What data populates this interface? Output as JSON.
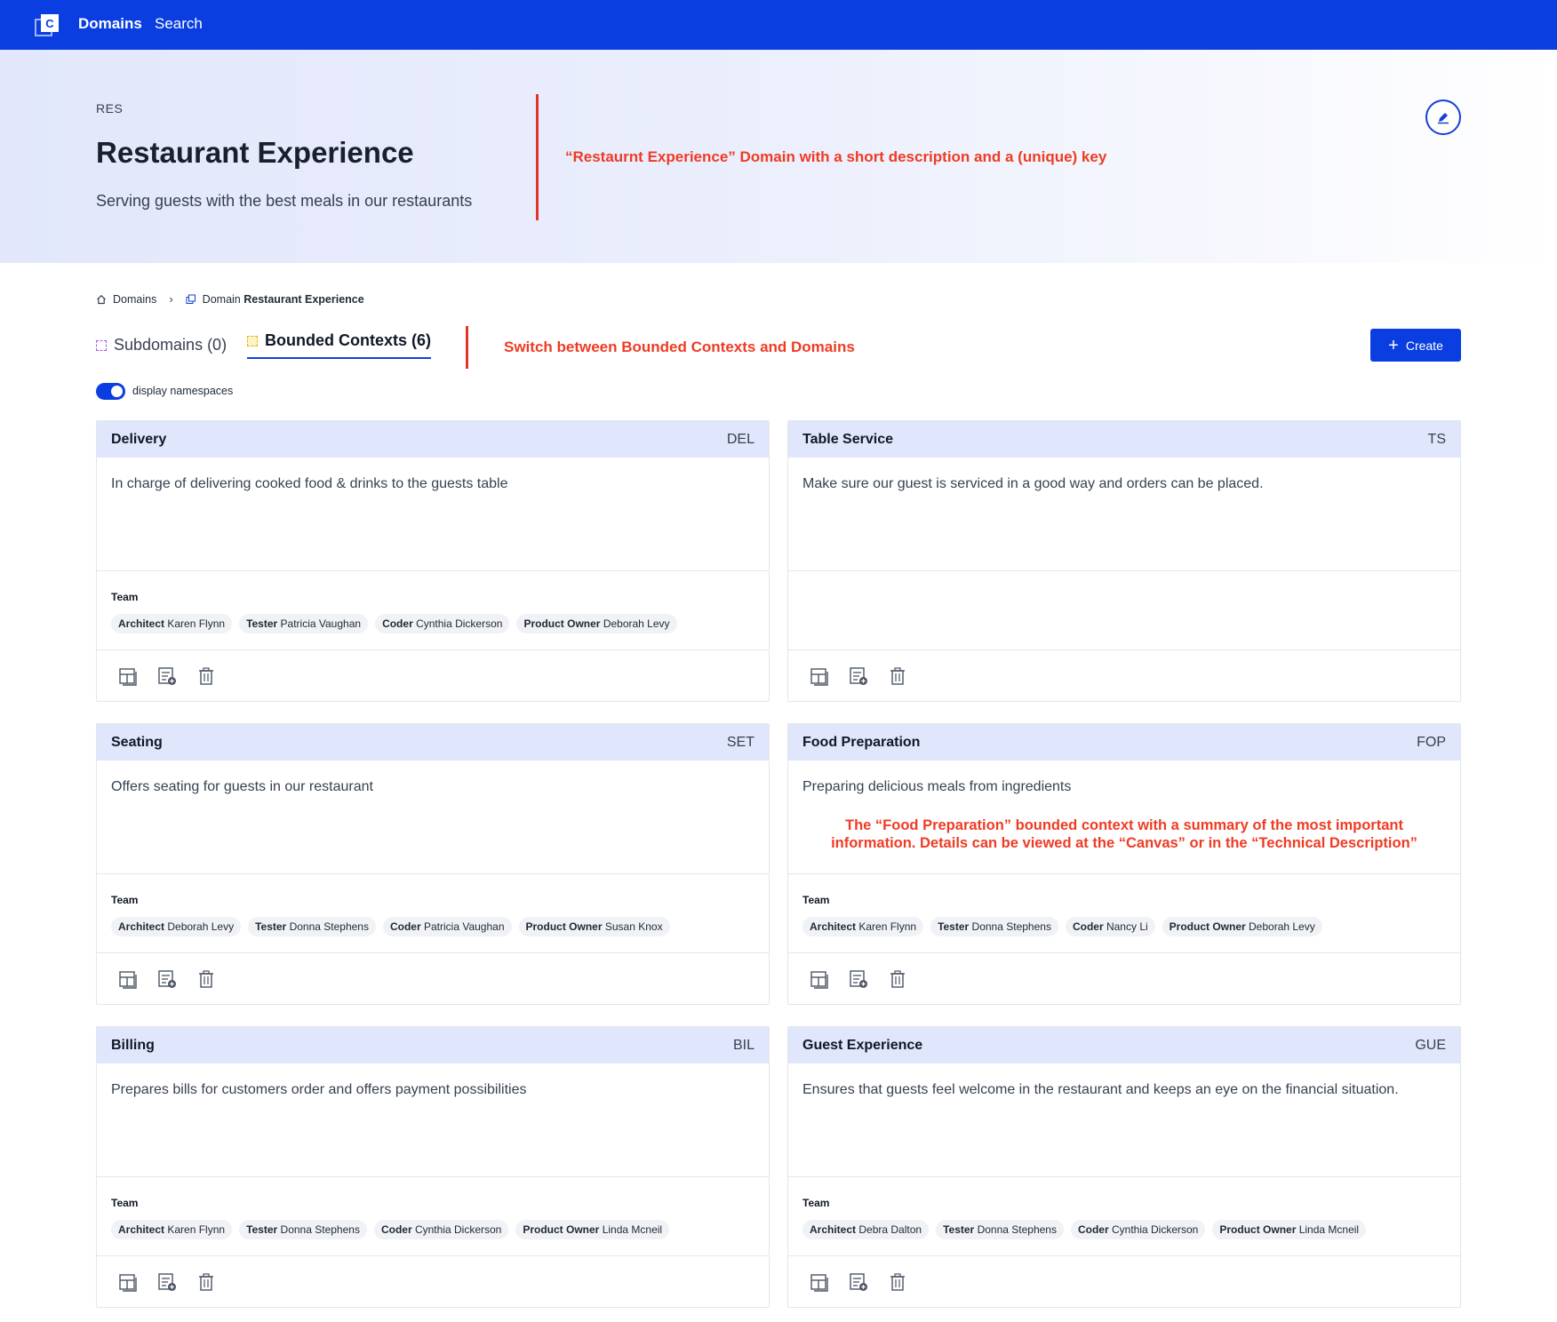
{
  "nav": {
    "domains_label": "Domains",
    "search_label": "Search",
    "logo_letter": "C"
  },
  "domain": {
    "key": "RES",
    "title": "Restaurant Experience",
    "description": "Serving guests with the best meals in our restaurants",
    "annotation": "“Restaurnt Experience” Domain with a short description and a (unique) key"
  },
  "breadcrumb": {
    "root": "Domains",
    "current_prefix": "Domain",
    "current_name": "Restaurant Experience"
  },
  "tabs": {
    "subdomains": "Subdomains (0)",
    "bounded_contexts": "Bounded Contexts (6)",
    "annotation": "Switch between Bounded Contexts and Domains"
  },
  "create_label": "Create",
  "toggle": {
    "label": "display namespaces",
    "on": true
  },
  "colors": {
    "brand": "#0a3ee0",
    "annotation": "#ef3b24",
    "card_header": "#e0e6fb"
  },
  "team_title": "Team",
  "cards": [
    {
      "name": "Delivery",
      "key": "DEL",
      "description": "In charge of delivering cooked food & drinks to the guests table",
      "team": [
        {
          "role": "Architect",
          "person": "Karen Flynn"
        },
        {
          "role": "Tester",
          "person": "Patricia Vaughan"
        },
        {
          "role": "Coder",
          "person": "Cynthia Dickerson"
        },
        {
          "role": "Product Owner",
          "person": "Deborah Levy"
        }
      ]
    },
    {
      "name": "Table Service",
      "key": "TS",
      "description": "Make sure our guest is serviced in a good way and orders can be placed.",
      "team": []
    },
    {
      "name": "Seating",
      "key": "SET",
      "description": "Offers seating for guests in our restaurant",
      "team": [
        {
          "role": "Architect",
          "person": "Deborah Levy"
        },
        {
          "role": "Tester",
          "person": "Donna Stephens"
        },
        {
          "role": "Coder",
          "person": "Patricia Vaughan"
        },
        {
          "role": "Product Owner",
          "person": "Susan Knox"
        }
      ]
    },
    {
      "name": "Food Preparation",
      "key": "FOP",
      "description": "Preparing delicious meals from ingredients",
      "annotation_line1": "The “Food Preparation” bounded context with a summary of the most important",
      "annotation_line2": "information. Details can be viewed at the “Canvas” or in the “Technical Description”",
      "team": [
        {
          "role": "Architect",
          "person": "Karen Flynn"
        },
        {
          "role": "Tester",
          "person": "Donna Stephens"
        },
        {
          "role": "Coder",
          "person": "Nancy Li"
        },
        {
          "role": "Product Owner",
          "person": "Deborah Levy"
        }
      ]
    },
    {
      "name": "Billing",
      "key": "BIL",
      "description": "Prepares bills for customers order and offers payment possibilities",
      "team": [
        {
          "role": "Architect",
          "person": "Karen Flynn"
        },
        {
          "role": "Tester",
          "person": "Donna Stephens"
        },
        {
          "role": "Coder",
          "person": "Cynthia Dickerson"
        },
        {
          "role": "Product Owner",
          "person": "Linda Mcneil"
        }
      ]
    },
    {
      "name": "Guest Experience",
      "key": "GUE",
      "description": "Ensures that guests feel welcome in the restaurant and keeps an eye on the financial situation.",
      "team": [
        {
          "role": "Architect",
          "person": "Debra Dalton"
        },
        {
          "role": "Tester",
          "person": "Donna Stephens"
        },
        {
          "role": "Coder",
          "person": "Cynthia Dickerson"
        },
        {
          "role": "Product Owner",
          "person": "Linda Mcneil"
        }
      ]
    }
  ],
  "card_actions": [
    "canvas-icon",
    "technical-description-icon",
    "delete-icon"
  ]
}
